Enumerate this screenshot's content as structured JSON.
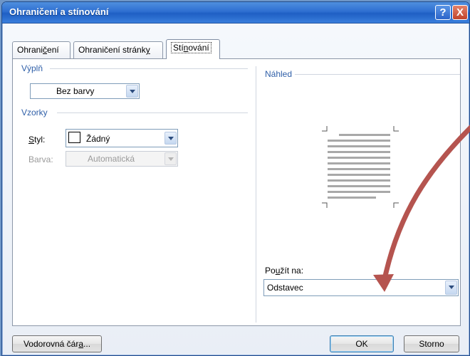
{
  "window": {
    "title": "Ohraničení a stínování"
  },
  "titlebar_buttons": {
    "help": "?",
    "close": "X"
  },
  "tabs": [
    {
      "prefix": "Ohrani",
      "mnemonic": "č",
      "suffix": "ení"
    },
    {
      "prefix": "Ohraničení stránk",
      "mnemonic": "y",
      "suffix": ""
    },
    {
      "prefix": "Stí",
      "mnemonic": "n",
      "suffix": "ování"
    }
  ],
  "fill": {
    "group_label": "Výplň",
    "value": "Bez barvy"
  },
  "patterns": {
    "group_label": "Vzorky",
    "style_label_mnemonic": "S",
    "style_label_rest": "tyl:",
    "style_value": "Žádný",
    "color_label": "Barva:",
    "color_value": "Automatická"
  },
  "preview": {
    "group_label": "Náhled"
  },
  "apply_to": {
    "label_prefix": "Po",
    "label_mnemonic": "u",
    "label_suffix": "žít na:",
    "value": "Odstavec"
  },
  "buttons": {
    "horizontal_line_prefix": "Vodorovná čár",
    "horizontal_line_mnemonic": "a",
    "horizontal_line_suffix": "...",
    "ok": "OK",
    "cancel": "Storno"
  },
  "colors": {
    "title_bar": "#2e6fd1",
    "annotation_arrow": "#b5544f",
    "group_label": "#2f5fa8"
  }
}
